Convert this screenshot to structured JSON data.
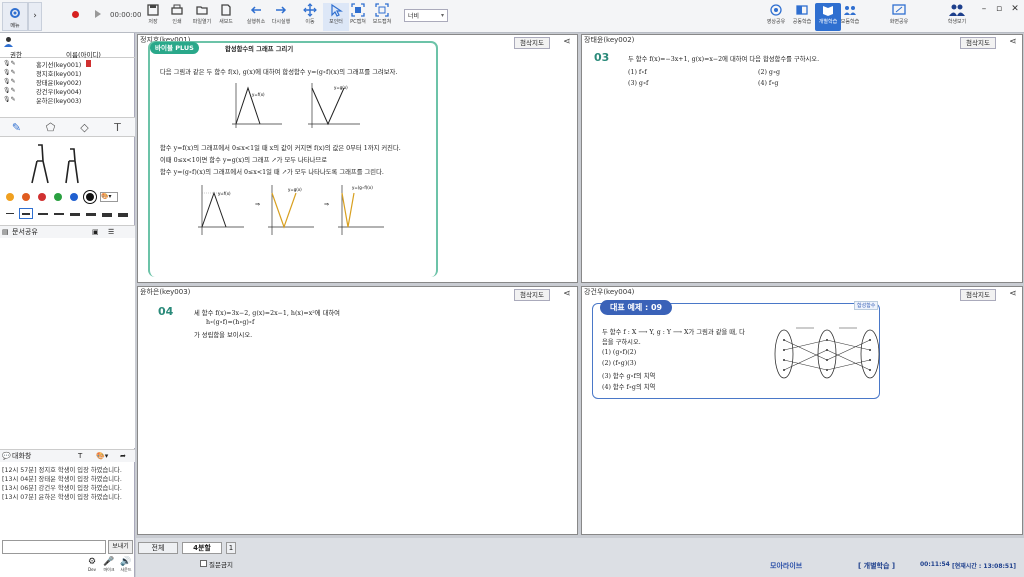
{
  "toolbar": {
    "menu_label": "메뉴",
    "timer": "00:00:00",
    "items": [
      {
        "label": "저장",
        "icon": "save-icon"
      },
      {
        "label": "인쇄",
        "icon": "print-icon"
      },
      {
        "label": "파일열기",
        "icon": "folder-open-icon"
      },
      {
        "label": "새보드",
        "icon": "new-board-icon"
      },
      {
        "label": "실행취소",
        "icon": "undo-icon"
      },
      {
        "label": "다시실행",
        "icon": "redo-icon"
      },
      {
        "label": "이동",
        "icon": "move-icon"
      },
      {
        "label": "포인터",
        "icon": "pointer-icon"
      },
      {
        "label": "PC캡쳐",
        "icon": "pc-capture-icon"
      },
      {
        "label": "보드캡쳐",
        "icon": "board-capture-icon"
      }
    ],
    "width_select": "너비",
    "right_items": [
      {
        "label": "영상공유",
        "icon": "video-share-icon"
      },
      {
        "label": "공동학습",
        "icon": "group-study-icon"
      },
      {
        "label": "개별학습",
        "icon": "individual-study-icon"
      },
      {
        "label": "모둠학습",
        "icon": "team-study-icon"
      },
      {
        "label": "화면공유",
        "icon": "screen-share-icon"
      },
      {
        "label": "학생보기",
        "icon": "student-view-icon"
      }
    ]
  },
  "user_list": {
    "col_permission": "권한",
    "col_name": "이름(아이디)",
    "users": [
      {
        "name": "홍기선(key001)"
      },
      {
        "name": "정지호(key001)"
      },
      {
        "name": "장태윤(key002)"
      },
      {
        "name": "강건우(key004)"
      },
      {
        "name": "윤하은(key003)"
      }
    ]
  },
  "draw_colors": [
    "#f0a020",
    "#e05c20",
    "#d03030",
    "#2aa040",
    "#2060d0",
    "#111111"
  ],
  "doc_share": {
    "title": "문서공유"
  },
  "chat": {
    "title": "대화창",
    "messages": [
      "[12시 57분] 정지호 학생이 입장 하였습니다.",
      "[13시 04분] 장태윤 학생이 입장 하였습니다.",
      "[13시 06분] 강건우 학생이 입장 하였습니다.",
      "[13시 07분] 윤하은 학생이 입장 하였습니다."
    ],
    "send_label": "보내기",
    "bottom_icons": [
      {
        "label": "Dev",
        "icon": "settings-icon"
      },
      {
        "label": "마이크",
        "icon": "mic-icon"
      },
      {
        "label": "사운드",
        "icon": "speaker-icon"
      }
    ]
  },
  "panes": [
    {
      "title": "정지호(key001)",
      "button": "첨삭지도",
      "badge": "바이블 PLUS",
      "heading": "합성함수의 그래프 그리기",
      "lines": [
        "다음 그림과 같은 두 함수 f(x), g(x)에 대하여 합성함수 y=(g∘f)(x)의 그래프를 그려보자.",
        "함수 y=f(x)의 그래프에서 0≤x<1일 때 x의 값이 커지면 f(x)의 값은 0부터 1까지 커진다.",
        "이때 0≤x<1이면 함수 y=g(x)의 그래프 ↗가 모두 나타나므로",
        "함수 y=(g∘f)(x)의 그래프에서 0≤x<1일 때 ↗가 모두 나타나도록 그래프를 그린다."
      ],
      "graph_labels": [
        "y=f(x)",
        "y=g(x)",
        "y=f(x)",
        "y=g(x)",
        "y=(g∘f)(x)"
      ]
    },
    {
      "title": "장태윤(key002)",
      "button": "첨삭지도",
      "number": "03",
      "question": "두 함수 f(x)=−3x+1, g(x)=x−2에 대하여 다음 합성함수를 구하시오.",
      "options": [
        "(1) f∘f",
        "(2) g∘g",
        "(3) g∘f",
        "(4) f∘g"
      ]
    },
    {
      "title": "윤하은(key003)",
      "button": "첨삭지도",
      "number": "04",
      "lines": [
        "세 함수 f(x)=3x−2, g(x)=2x−1, h(x)=x²에 대하여",
        "h∘(g∘f)=(h∘g)∘f",
        "가 성립함을 보이시오."
      ]
    },
    {
      "title": "강건우(key004)",
      "button": "첨삭지도",
      "badge": "대표 예제 : 09",
      "tag": "합성함수",
      "question_l1": "두 함수 f : X ⟶ Y, g : Y ⟶ X가 그림과 같을 때, 다",
      "question_l2": "음을 구하시오.",
      "options": [
        "(1) (g∘f)(2)",
        "(2) (f∘g)(3)",
        "(3) 함수 g∘f의 치역",
        "(4) 함수 f∘g의 치역"
      ]
    }
  ],
  "bottom": {
    "tab_all": "전체",
    "tab_split": "4분할",
    "page": "1",
    "question_check": "질문금지",
    "brand": "모아라이브",
    "mode": "[ 개별학습 ]",
    "elapsed": "00:11:54",
    "current_time": "[현재시간 : 13:08:51]"
  }
}
